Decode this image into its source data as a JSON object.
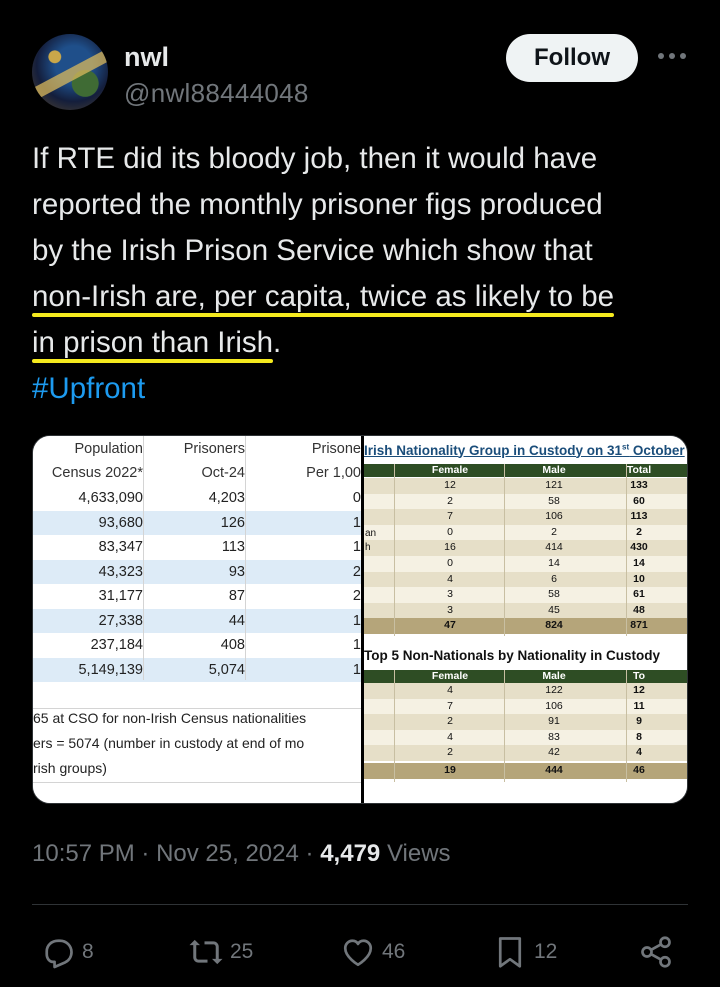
{
  "author": {
    "name": "nwl",
    "handle": "@nwl88444048",
    "follow_label": "Follow",
    "more_icon": "more-icon"
  },
  "tweet": {
    "lines": [
      "If RTE did its bloody job, then it would have",
      "reported the monthly prisoner figs produced",
      "by the Irish Prison Service which show that"
    ],
    "highlight_1": "non-Irish are, per capita, twice as likely to be",
    "highlight_2": "in prison than Irish",
    "highlight_2_suffix": ".",
    "hashtag": "#Upfront"
  },
  "left_table": {
    "headers_row1": [
      "Population",
      "Prisoners",
      "Prisone"
    ],
    "headers_row2": [
      "Census 2022*",
      "Oct-24",
      "Per 1,00"
    ],
    "rows": [
      [
        "4,633,090",
        "4,203",
        "0"
      ],
      [
        "93,680",
        "126",
        "1"
      ],
      [
        "83,347",
        "113",
        "1"
      ],
      [
        "43,323",
        "93",
        "2"
      ],
      [
        "31,177",
        "87",
        "2"
      ],
      [
        "27,338",
        "44",
        "1"
      ],
      [
        "237,184",
        "408",
        "1"
      ],
      [
        "5,149,139",
        "5,074",
        "1"
      ]
    ],
    "notes": [
      "65 at CSO for non-Irish Census nationalities",
      "ers = 5074 (number in custody at end of mo",
      "rish groups)"
    ]
  },
  "right_table_1": {
    "title_prefix": "Irish Nationality Group in Custody on 31",
    "title_sup": "st",
    "title_suffix": " October",
    "headers": [
      "Female",
      "Male",
      "Total"
    ],
    "side_labels": [
      "an",
      "h"
    ],
    "rows": [
      [
        "12",
        "121",
        "133"
      ],
      [
        "2",
        "58",
        "60"
      ],
      [
        "7",
        "106",
        "113"
      ],
      [
        "0",
        "2",
        "2"
      ],
      [
        "16",
        "414",
        "430"
      ],
      [
        "0",
        "14",
        "14"
      ],
      [
        "4",
        "6",
        "10"
      ],
      [
        "3",
        "58",
        "61"
      ],
      [
        "3",
        "45",
        "48"
      ]
    ],
    "total": [
      "47",
      "824",
      "871"
    ]
  },
  "right_table_2": {
    "title": "Top 5 Non-Nationals by Nationality in Custody",
    "headers": [
      "Female",
      "Male",
      "To"
    ],
    "rows": [
      [
        "4",
        "122",
        "12"
      ],
      [
        "7",
        "106",
        "11"
      ],
      [
        "2",
        "91",
        "9"
      ],
      [
        "4",
        "83",
        "8"
      ],
      [
        "2",
        "42",
        "4"
      ]
    ],
    "total": [
      "19",
      "444",
      "46"
    ]
  },
  "meta": {
    "time": "10:57 PM",
    "dot": "·",
    "date": "Nov 25, 2024",
    "views_count": "4,479",
    "views_label": "Views"
  },
  "actions": {
    "reply_count": "8",
    "repost_count": "25",
    "like_count": "46",
    "bookmark_count": "12"
  },
  "colors": {
    "background": "#000000",
    "text": "#e7e9ea",
    "muted": "#71767b",
    "link": "#1d9bf0",
    "highlight": "#f5ea1e"
  }
}
